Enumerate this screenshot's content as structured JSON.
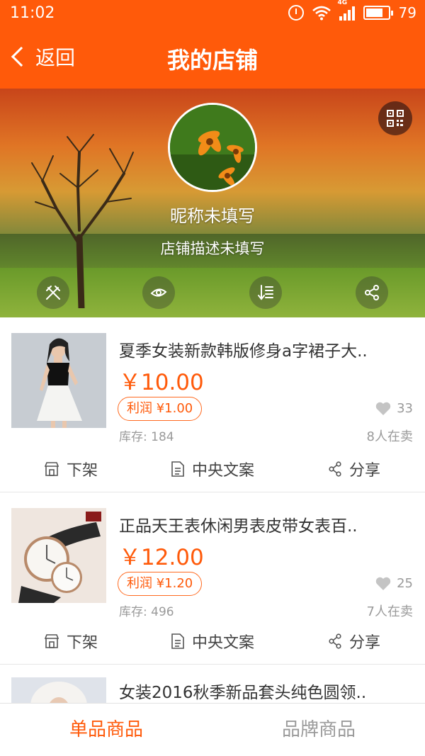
{
  "status": {
    "time": "11:02",
    "network": "4G",
    "battery": "79",
    "battery_level": 0.79
  },
  "nav": {
    "back_label": "返回",
    "title": "我的店铺"
  },
  "shop": {
    "nickname": "昵称未填写",
    "description": "店铺描述未填写"
  },
  "products": [
    {
      "title": "夏季女装新款韩版修身a字裙子大..",
      "price": "￥10.00",
      "profit": "利润 ¥1.00",
      "stock": "库存: 184",
      "likes": "33",
      "sellers": "8人在卖"
    },
    {
      "title": "正品天王表休闲男表皮带女表百..",
      "price": "￥12.00",
      "profit": "利润 ¥1.20",
      "stock": "库存: 496",
      "likes": "25",
      "sellers": "7人在卖"
    },
    {
      "title": "女装2016秋季新品套头纯色圆领.."
    }
  ],
  "actions": {
    "unlist": "下架",
    "copy": "中央文案",
    "share": "分享"
  },
  "tabs": [
    {
      "label": "单品商品",
      "active": true
    },
    {
      "label": "品牌商品",
      "active": false
    }
  ],
  "colors": {
    "brand": "#ff5a0a",
    "muted": "#9a9a9a"
  },
  "icons": [
    "alarm-icon",
    "wifi-icon",
    "signal-icon",
    "battery-icon",
    "back-icon",
    "qr-code-icon",
    "tools-icon",
    "eye-icon",
    "sort-icon",
    "share-icon",
    "heart-icon",
    "store-icon",
    "document-icon"
  ]
}
